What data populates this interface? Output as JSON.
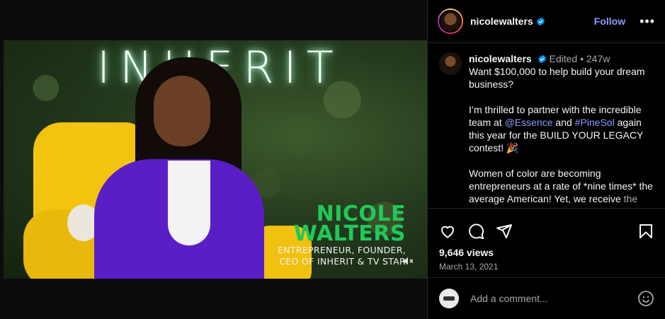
{
  "video": {
    "neon_sign": "INHERIT",
    "lower_third_name_line1": "NICOLE",
    "lower_third_name_line2": "WALTERS",
    "lower_third_title_line1": "ENTREPRENEUR, FOUNDER,",
    "lower_third_title_line2": "CEO OF INHERIT & TV STAR",
    "mute_icon": "speaker-muted-icon"
  },
  "header": {
    "username": "nicolewalters",
    "follow_label": "Follow",
    "more_label": "•••",
    "verified_color": "#0095f6"
  },
  "caption": {
    "username": "nicolewalters",
    "edited_label": "Edited",
    "separator": "•",
    "age": "247w",
    "paragraph1": "Want $100,000 to help build your dream business?",
    "p2_before": "I’m thrilled to partner with the incredible team at ",
    "p2_mention1": "@Essence",
    "p2_and": " and ",
    "p2_mention2": "#PineSol",
    "p2_after": " again this year for the BUILD YOUR LEGACY contest! 🎉",
    "paragraph3": "Women of color are becoming entrepreneurs at a rate of *nine times* the average American! Yet, we receive",
    "paragraph3_partial": "the least amount of funding and..."
  },
  "actions": {
    "icons": [
      "heart-icon",
      "comment-icon",
      "share-icon",
      "bookmark-icon"
    ],
    "views": "9,646 views",
    "date": "March 13, 2021"
  },
  "comment": {
    "placeholder": "Add a comment...",
    "emoji_icon": "emoji-icon"
  },
  "colors": {
    "link": "#8f9bff",
    "lower_third_green": "#1fc95a",
    "jacket_purple": "#5a1ec6",
    "chair_yellow": "#f2c40f"
  }
}
